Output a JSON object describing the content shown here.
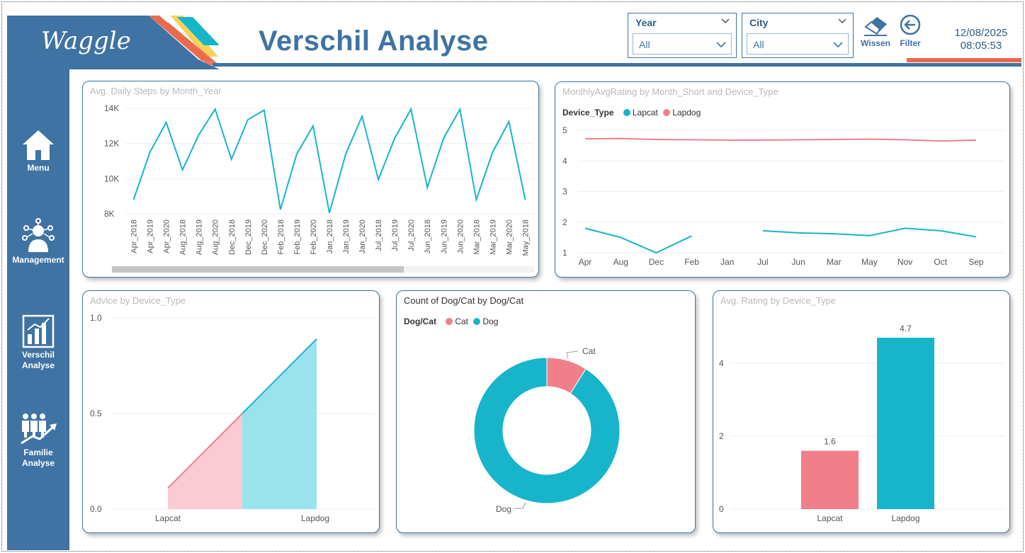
{
  "header": {
    "logo_text": "Waggle",
    "title": "Verschil Analyse",
    "slicers": [
      {
        "label": "Year",
        "value": "All"
      },
      {
        "label": "City",
        "value": "All"
      }
    ],
    "buttons": [
      {
        "label": "Wissen",
        "icon": "eraser-icon"
      },
      {
        "label": "Filter",
        "icon": "back-arrow-icon"
      }
    ],
    "date": "12/08/2025",
    "time": "08:05:53",
    "colors": {
      "primary": "#3f73a3",
      "accent_orange": "#ea6a4c",
      "accent_yellow": "#f5d25a",
      "accent_teal": "#17b5c9"
    }
  },
  "sidebar": {
    "items": [
      {
        "label": "Menu",
        "icon": "home-icon"
      },
      {
        "label": "Management",
        "icon": "network-person-icon"
      },
      {
        "label": "Verschil Analyse",
        "icon": "bar-chart-icon"
      },
      {
        "label": "Familie Analyse",
        "icon": "family-growth-icon"
      }
    ]
  },
  "chart_data": [
    {
      "id": "steps",
      "type": "line",
      "title": "Avg. Daily Steps by Month_Year",
      "categories": [
        "Apr_2018",
        "Apr_2019",
        "Apr_2020",
        "Aug_2018",
        "Aug_2019",
        "Aug_2020",
        "Dec_2018",
        "Dec_2019",
        "Dec_2020",
        "Feb_2018",
        "Feb_2019",
        "Feb_2020",
        "Jan_2018",
        "Jan_2019",
        "Jan_2020",
        "Jul_2018",
        "Jul_2019",
        "Jul_2020",
        "Jun_2018",
        "Jun_2019",
        "Jun_2020",
        "Mar_2018",
        "Mar_2019",
        "Mar_2020",
        "May_2018"
      ],
      "values": [
        8800,
        11500,
        13200,
        10500,
        12500,
        13950,
        11100,
        13350,
        13900,
        8250,
        11400,
        13000,
        8050,
        11400,
        13550,
        9950,
        12300,
        13950,
        9500,
        12300,
        13950,
        8800,
        11500,
        13250,
        8800
      ],
      "y_ticks": [
        "8K",
        "10K",
        "12K",
        "14K"
      ],
      "ylim": [
        8000,
        14000
      ],
      "color": "#17b5c9",
      "scrollbar": true
    },
    {
      "id": "rating_month",
      "type": "line",
      "title": "MonthlyAvgRating by Month_Short and Device_Type",
      "legend_title": "Device_Type",
      "categories": [
        "Apr",
        "Aug",
        "Dec",
        "Feb",
        "Jan",
        "Jul",
        "Jun",
        "Mar",
        "May",
        "Nov",
        "Oct",
        "Sep"
      ],
      "series": [
        {
          "name": "Lapcat",
          "color": "#17b5c9",
          "values": [
            1.8,
            1.5,
            1.0,
            1.55,
            null,
            1.72,
            1.65,
            1.62,
            1.56,
            1.8,
            1.72,
            1.52
          ]
        },
        {
          "name": "Lapdog",
          "color": "#f07f8a",
          "values": [
            4.72,
            4.73,
            4.7,
            4.69,
            4.68,
            4.68,
            4.69,
            4.7,
            4.71,
            4.69,
            4.65,
            4.68
          ]
        }
      ],
      "y_ticks": [
        "1",
        "2",
        "3",
        "4",
        "5"
      ],
      "ylim": [
        1,
        5
      ]
    },
    {
      "id": "advice",
      "type": "area",
      "title": "Advice by Device_Type",
      "categories": [
        "Lapcat",
        "Lapdog"
      ],
      "series": [
        {
          "name": "Lapcat",
          "color": "#f07f8a",
          "fill": "#f9cbd2",
          "values": [
            0.11,
            0.5
          ]
        },
        {
          "name": "Lapdog",
          "color": "#17b5c9",
          "fill": "#9ae3ec",
          "values": [
            0.5,
            0.89
          ]
        }
      ],
      "y_ticks": [
        "0.0",
        "0.5",
        "1.0"
      ],
      "ylim": [
        0,
        1
      ]
    },
    {
      "id": "dogcat",
      "type": "pie",
      "title": "Count of Dog/Cat by Dog/Cat",
      "legend_title": "Dog/Cat",
      "slices": [
        {
          "label": "Cat",
          "value": 9,
          "color": "#f07f8a"
        },
        {
          "label": "Dog",
          "value": 91,
          "color": "#17b5c9"
        }
      ]
    },
    {
      "id": "avg_rating",
      "type": "bar",
      "title": "Avg. Rating by Device_Type",
      "categories": [
        "Lapcat",
        "Lapdog"
      ],
      "values": [
        1.6,
        4.7
      ],
      "value_labels": [
        "1.6",
        "4.7"
      ],
      "colors": [
        "#f07f8a",
        "#17b5c9"
      ],
      "y_ticks": [
        "0",
        "2",
        "4"
      ],
      "ylim": [
        0,
        5.05
      ]
    }
  ]
}
